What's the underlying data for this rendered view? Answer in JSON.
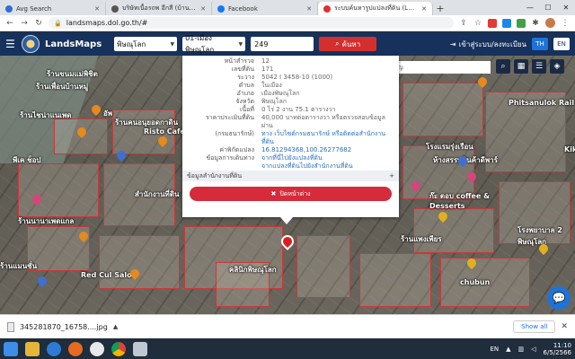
{
  "browser": {
    "tabs": [
      {
        "title": "Avg Search",
        "color": "#2f6fd6",
        "active": false
      },
      {
        "title": "บริษัทเนื้อรถพ อีกสี (บ้านรีชไฟ) จำกัด",
        "color": "#555555",
        "active": false
      },
      {
        "title": "Facebook",
        "color": "#1877f2",
        "active": false
      },
      {
        "title": "ระบบค้นหารูปแปลงที่ดิน (LandsMaps)",
        "color": "#e03131",
        "active": true
      }
    ],
    "url": "landsmaps.dol.go.th/#"
  },
  "header": {
    "brand": "LandsMaps",
    "province": "พิษณุโลก",
    "district": "01-เมืองพิษณุโลก",
    "parcel_no": "249",
    "search_label": "ค้นหา",
    "login_label": "เข้าสู่ระบบ/ลงทะเบียน",
    "lang_th": "TH",
    "lang_en": "EN"
  },
  "map": {
    "search_placeholder": "ค้นหาสถานที่สำคัญ",
    "labels": [
      "ร้านขนมแม่พิชิต",
      "ร้านเพื่อนบ้านหมู่",
      "ร้านไชน่าแนเพด",
      "Phitsanulok Rail Station Night Mar",
      "Kik",
      "อัพ",
      "ร้านคนอนุยอดกาดิน",
      "Risto Café",
      "พีเค ช็อป",
      "สำนักงานที่ดิน",
      "โรงแรมรุ่งเรือน",
      "ห้างสรรพสินค้าดีพาร์",
      "ก๊ะ ตอบ coffee & Desserts",
      "โรงพยาบาล 2 พิษณุโลก",
      "ร้านนานาเพดแกล",
      "ร้านแพงเพียร",
      "chubun",
      "คลินิกพิษณุโลก",
      "Red Cul Salon",
      "ร้านแมนชั่น"
    ]
  },
  "parcel_info": {
    "rows": [
      {
        "k": "หน้าสำรวจ",
        "v": "12"
      },
      {
        "k": "เลขที่ดิน",
        "v": "171"
      },
      {
        "k": "ระวาง",
        "v": "5042 I 3458-10 (1000)"
      },
      {
        "k": "ตำบล",
        "v": "ในเมือง"
      },
      {
        "k": "อำเภอ",
        "v": "เมืองพิษณุโลก"
      },
      {
        "k": "จังหวัด",
        "v": "พิษณุโลก"
      },
      {
        "k": "เนื้อที่",
        "v": "0 ไร่ 2 งาน 75.1 ตารางวา"
      },
      {
        "k": "ราคาประเมินที่ดิน",
        "v": "40,000 บาทต่อตารางวา หรือตรวจสอบข้อมูลผ่าน"
      },
      {
        "k": "(กรมธนารักษ์)",
        "v": "ทาง เว็บไซต์กรมธนารักษ์ หรือติดต่อสำนักงานที่ดิน"
      },
      {
        "k": "ค่าพิกัดแปลง",
        "v": "16.81294368,100.26277682"
      },
      {
        "k": "ข้อมูลการเดินทาง",
        "v": "จากที่นี่ไปยังแปลงที่ดิน"
      },
      {
        "k": "",
        "v": "จากแปลงที่ดินไปยังสำนักงานที่ดิน"
      }
    ],
    "section_title": "ข้อมูลสำนักงานที่ดิน",
    "section_toggle": "+",
    "close_label": "ปิดหน้าต่าง"
  },
  "downloads": {
    "file_name": "345281870_16758....jpg",
    "show_all": "Show all"
  },
  "taskbar": {
    "lang": "EN",
    "time": "11:10",
    "date": "6/5/2566"
  }
}
